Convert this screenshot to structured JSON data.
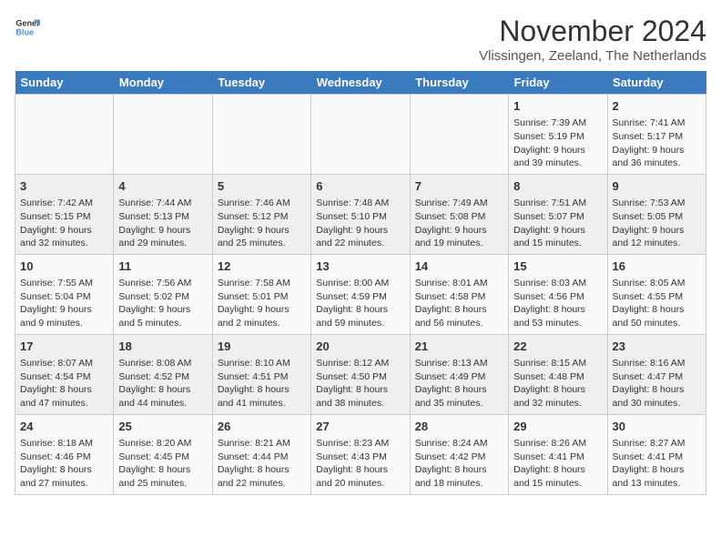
{
  "logo": {
    "line1": "General",
    "line2": "Blue"
  },
  "title": "November 2024",
  "location": "Vlissingen, Zeeland, The Netherlands",
  "headers": [
    "Sunday",
    "Monday",
    "Tuesday",
    "Wednesday",
    "Thursday",
    "Friday",
    "Saturday"
  ],
  "weeks": [
    [
      {
        "day": "",
        "info": ""
      },
      {
        "day": "",
        "info": ""
      },
      {
        "day": "",
        "info": ""
      },
      {
        "day": "",
        "info": ""
      },
      {
        "day": "",
        "info": ""
      },
      {
        "day": "1",
        "info": "Sunrise: 7:39 AM\nSunset: 5:19 PM\nDaylight: 9 hours and 39 minutes."
      },
      {
        "day": "2",
        "info": "Sunrise: 7:41 AM\nSunset: 5:17 PM\nDaylight: 9 hours and 36 minutes."
      }
    ],
    [
      {
        "day": "3",
        "info": "Sunrise: 7:42 AM\nSunset: 5:15 PM\nDaylight: 9 hours and 32 minutes."
      },
      {
        "day": "4",
        "info": "Sunrise: 7:44 AM\nSunset: 5:13 PM\nDaylight: 9 hours and 29 minutes."
      },
      {
        "day": "5",
        "info": "Sunrise: 7:46 AM\nSunset: 5:12 PM\nDaylight: 9 hours and 25 minutes."
      },
      {
        "day": "6",
        "info": "Sunrise: 7:48 AM\nSunset: 5:10 PM\nDaylight: 9 hours and 22 minutes."
      },
      {
        "day": "7",
        "info": "Sunrise: 7:49 AM\nSunset: 5:08 PM\nDaylight: 9 hours and 19 minutes."
      },
      {
        "day": "8",
        "info": "Sunrise: 7:51 AM\nSunset: 5:07 PM\nDaylight: 9 hours and 15 minutes."
      },
      {
        "day": "9",
        "info": "Sunrise: 7:53 AM\nSunset: 5:05 PM\nDaylight: 9 hours and 12 minutes."
      }
    ],
    [
      {
        "day": "10",
        "info": "Sunrise: 7:55 AM\nSunset: 5:04 PM\nDaylight: 9 hours and 9 minutes."
      },
      {
        "day": "11",
        "info": "Sunrise: 7:56 AM\nSunset: 5:02 PM\nDaylight: 9 hours and 5 minutes."
      },
      {
        "day": "12",
        "info": "Sunrise: 7:58 AM\nSunset: 5:01 PM\nDaylight: 9 hours and 2 minutes."
      },
      {
        "day": "13",
        "info": "Sunrise: 8:00 AM\nSunset: 4:59 PM\nDaylight: 8 hours and 59 minutes."
      },
      {
        "day": "14",
        "info": "Sunrise: 8:01 AM\nSunset: 4:58 PM\nDaylight: 8 hours and 56 minutes."
      },
      {
        "day": "15",
        "info": "Sunrise: 8:03 AM\nSunset: 4:56 PM\nDaylight: 8 hours and 53 minutes."
      },
      {
        "day": "16",
        "info": "Sunrise: 8:05 AM\nSunset: 4:55 PM\nDaylight: 8 hours and 50 minutes."
      }
    ],
    [
      {
        "day": "17",
        "info": "Sunrise: 8:07 AM\nSunset: 4:54 PM\nDaylight: 8 hours and 47 minutes."
      },
      {
        "day": "18",
        "info": "Sunrise: 8:08 AM\nSunset: 4:52 PM\nDaylight: 8 hours and 44 minutes."
      },
      {
        "day": "19",
        "info": "Sunrise: 8:10 AM\nSunset: 4:51 PM\nDaylight: 8 hours and 41 minutes."
      },
      {
        "day": "20",
        "info": "Sunrise: 8:12 AM\nSunset: 4:50 PM\nDaylight: 8 hours and 38 minutes."
      },
      {
        "day": "21",
        "info": "Sunrise: 8:13 AM\nSunset: 4:49 PM\nDaylight: 8 hours and 35 minutes."
      },
      {
        "day": "22",
        "info": "Sunrise: 8:15 AM\nSunset: 4:48 PM\nDaylight: 8 hours and 32 minutes."
      },
      {
        "day": "23",
        "info": "Sunrise: 8:16 AM\nSunset: 4:47 PM\nDaylight: 8 hours and 30 minutes."
      }
    ],
    [
      {
        "day": "24",
        "info": "Sunrise: 8:18 AM\nSunset: 4:46 PM\nDaylight: 8 hours and 27 minutes."
      },
      {
        "day": "25",
        "info": "Sunrise: 8:20 AM\nSunset: 4:45 PM\nDaylight: 8 hours and 25 minutes."
      },
      {
        "day": "26",
        "info": "Sunrise: 8:21 AM\nSunset: 4:44 PM\nDaylight: 8 hours and 22 minutes."
      },
      {
        "day": "27",
        "info": "Sunrise: 8:23 AM\nSunset: 4:43 PM\nDaylight: 8 hours and 20 minutes."
      },
      {
        "day": "28",
        "info": "Sunrise: 8:24 AM\nSunset: 4:42 PM\nDaylight: 8 hours and 18 minutes."
      },
      {
        "day": "29",
        "info": "Sunrise: 8:26 AM\nSunset: 4:41 PM\nDaylight: 8 hours and 15 minutes."
      },
      {
        "day": "30",
        "info": "Sunrise: 8:27 AM\nSunset: 4:41 PM\nDaylight: 8 hours and 13 minutes."
      }
    ]
  ]
}
